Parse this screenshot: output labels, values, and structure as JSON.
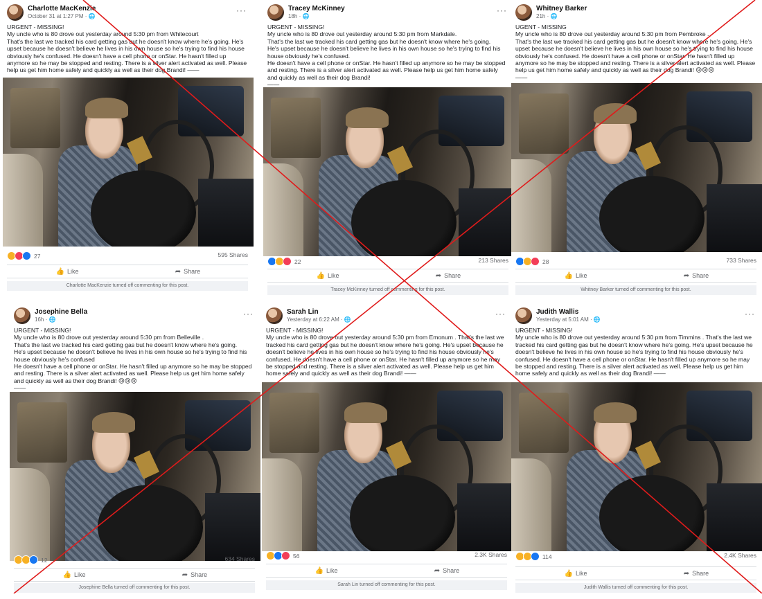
{
  "posts": [
    {
      "author": "Charlotte MacKenzie",
      "meta": "October 31 at 1:27 PM · ",
      "lines": [
        "URGENT - MISSING!",
        "My uncle who is 80 drove out yesterday around 5:30 pm from  Whitecourt",
        "That's the last we tracked his card getting gas but he doesn't know where he's going.  He's upset because he doesn't believe he lives in his own house so he's trying to find his house obviously he's confused.  He doesn't have a cell phone or onStar. He hasn't filled up anymore so he may be stopped and resting. There is a silver alert activated as well. Please help us get him home safely and quickly as well as their dog Brandi! ——"
      ],
      "reactions": "27",
      "shares": "595 Shares",
      "notice": "Charlotte MacKenzie turned off commenting for this post."
    },
    {
      "author": "Tracey McKinney",
      "meta": "18h · ",
      "lines": [
        "URGENT - MISSING!",
        "My uncle who is 80 drove out yesterday around 5:30 pm from  Markdale.",
        "That's the last we tracked his card getting gas but he doesn't know where he's going.",
        "He's upset because he doesn't believe he lives in his own house so he's trying to find his house obviously he's confused.",
        "He doesn't have a cell phone or onStar. He hasn't filled up anymore so he may be stopped and resting. There is a silver alert activated as well. Please help us get him home safely and quickly as well as their dog Brandi!",
        "——"
      ],
      "reactions": "22",
      "shares": "213 Shares",
      "notice": "Tracey McKinney turned off commenting for this post."
    },
    {
      "author": "Whitney Barker",
      "meta": "21h · ",
      "lines": [
        "UGENT - MISSING",
        "My uncle who is 80 drove out yesterday around 5:30 pm from Pembroke  .",
        "That's the last we tracked his card getting gas but he doesn't know where he's going.  He's upset because he doesn't believe he lives in his own house so he's trying to find his house obviously he's confused. He doesn't have a cell phone or onStar. He hasn't filled up anymore so he may be stopped and resting. There is a silver alert activated as well. Please help us get him home safely and quickly as well as their dog Brandi! 😢😢😢",
        "——"
      ],
      "reactions": "28",
      "shares": "733 Shares",
      "notice": "Whitney Barker turned off commenting for this post."
    },
    {
      "author": "Josephine Bella",
      "meta": "16h · ",
      "lines": [
        "URGENT - MISSING!",
        "My uncle who is 80 drove out yesterday around 5:30 pm from  Belleville .",
        "That's the last we tracked his card getting gas but he doesn't know where he's going.",
        "He's upset because he doesn't believe he lives in his own house so he's trying to find his house obviously he's confused",
        "He doesn't have a cell phone or onStar. He hasn't filled up anymore so he may be stopped and resting. There is a silver alert activated as well. Please help us get him home safely and quickly as well as their dog Brandi! 😢😢😢",
        "——"
      ],
      "reactions": "12",
      "shares": "634 Shares",
      "notice": "Josephine Bella turned off commenting for this post."
    },
    {
      "author": "Sarah Lin",
      "meta": "Yesterday at 6:22 AM · ",
      "lines": [
        "URGENT - MISSING!",
        "My uncle who is 80 drove out yesterday around 5:30 pm from  Emonum .  That's the last we tracked his card getting gas but he doesn't know where he's going.  He's upset because he doesn't believe he lives in his own house so he's trying to find his house obviously he's confused. He doesn't have a cell phone or onStar. He hasn't filled up anymore so he may be stopped and resting. There is a silver alert activated as well. Please help us get him home safely and quickly as well as their dog Brandi! ——"
      ],
      "reactions": "56",
      "shares": "2.3K Shares",
      "notice": "Sarah Lin turned off commenting for this post."
    },
    {
      "author": "Judith Wallis",
      "meta": "Yesterday at 5:01 AM · ",
      "lines": [
        "URGENT - MISSING!",
        "My uncle who is 80 drove out yesterday around 5:30 pm from  Timmins .  That's the last we tracked his card getting gas but he doesn't know where he's going.  He's upset because he doesn't believe he lives in his own house so he's trying to find his house obviously he's confused. He doesn't have a cell phone or onStar. He hasn't filled up anymore so he may be stopped and resting. There is a silver alert activated as well. Please help us get him home safely and quickly as well as their dog Brandi! ——"
      ],
      "reactions": "114",
      "shares": "2.4K Shares",
      "notice": "Judith Wallis turned off commenting for this post."
    }
  ],
  "ui": {
    "like_label": "Like",
    "share_label": "Share",
    "more_label": "···"
  },
  "colors": {
    "cross": "#e01b1b",
    "like_blue": "#1877f2",
    "muted_text": "#65676b"
  }
}
